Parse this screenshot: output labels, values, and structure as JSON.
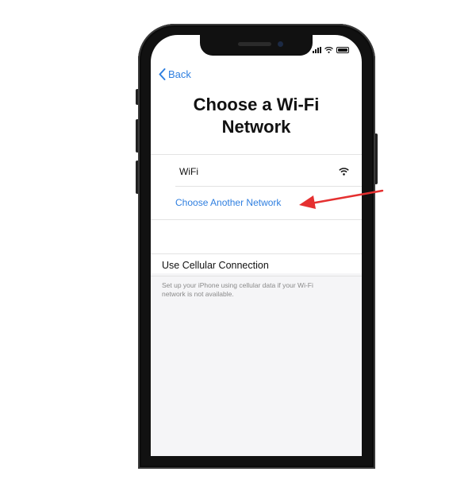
{
  "nav": {
    "back_label": "Back"
  },
  "header": {
    "title": "Choose a Wi-Fi Network"
  },
  "networks": [
    {
      "name": "WiFi",
      "icon": "wifi-icon"
    }
  ],
  "actions": {
    "choose_another": "Choose Another Network"
  },
  "cellular": {
    "title": "Use Cellular Connection",
    "description": "Set up your iPhone using cellular data if your Wi-Fi network is not available."
  },
  "colors": {
    "link_blue": "#2f7fe0",
    "annotation_red": "#e53030",
    "phone_frame": "#111111"
  },
  "annotation": {
    "type": "arrow",
    "points_to": "choose-another-network-link"
  }
}
